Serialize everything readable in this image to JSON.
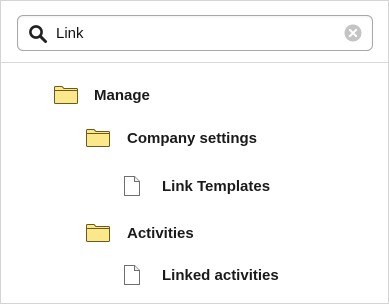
{
  "search": {
    "value": "Link",
    "icon": "search-icon",
    "clear_icon": "clear-icon"
  },
  "tree": {
    "manage": {
      "label": "Manage",
      "icon": "folder-icon"
    },
    "company_settings": {
      "label": "Company settings",
      "icon": "folder-icon"
    },
    "link_templates": {
      "label": "Link Templates",
      "icon": "document-icon"
    },
    "activities": {
      "label": "Activities",
      "icon": "folder-icon"
    },
    "linked_activities": {
      "label": "Linked activities",
      "icon": "document-icon"
    }
  },
  "colors": {
    "folder_fill": "#fbe88a",
    "folder_stroke": "#6b5a1e",
    "document_fill": "#ffffff",
    "document_stroke": "#6f6f6f",
    "text": "#1a1a1a",
    "border": "#a8a8a8"
  }
}
